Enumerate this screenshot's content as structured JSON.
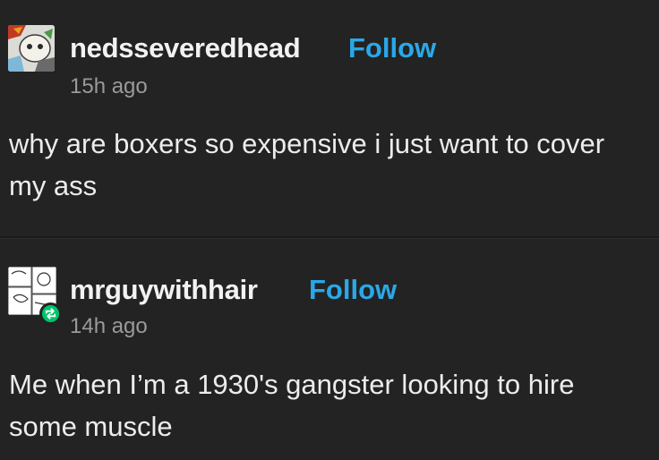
{
  "posts": [
    {
      "username": "nedsseveredhead",
      "follow_label": "Follow",
      "time": "15h ago",
      "body": "why are boxers so expensive i just want to cover my ass"
    },
    {
      "username": "mrguywithhair",
      "follow_label": "Follow",
      "time": "14h ago",
      "body": "Me when I’m a 1930's gangster looking to hire some muscle"
    }
  ],
  "icons": {
    "reblog_badge": "reblog-icon"
  },
  "colors": {
    "background": "#232323",
    "text": "#ececec",
    "follow": "#2aa8e8",
    "timestamp": "#9a9a9a",
    "reblog_badge": "#00c46a"
  }
}
